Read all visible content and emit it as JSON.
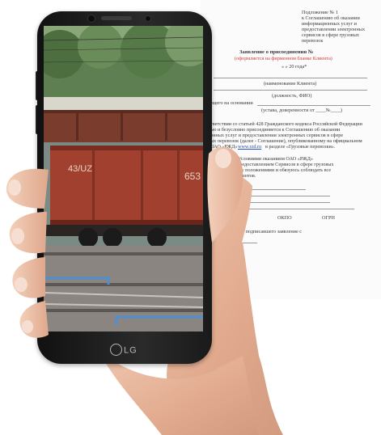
{
  "document": {
    "lines": [
      {
        "text": "Подложение № 1"
      },
      {
        "text": "к Соглашению об оказании"
      },
      {
        "text": "информационных услуг и"
      },
      {
        "text": "предоставлении электронных"
      },
      {
        "text": "сервисов в сфере грузовых"
      },
      {
        "text": "перевозок"
      },
      {
        "text": "Заявление о присоединении №"
      },
      {
        "text": "(оформляется на фирменном бланке Клиента)"
      },
      {
        "text": "«    »              20     года*"
      },
      {
        "text": "(наименование Клиента)"
      },
      {
        "text": "(должность, ФИО)"
      },
      {
        "text": "ющего на основании"
      },
      {
        "text": "(устава, доверенности от ____№____)"
      },
      {
        "text": "тветствии со статьей 428 Гражданского кодекса Российской Федерации"
      },
      {
        "text": "ью и безусловно присоединяется к Соглашению об оказании"
      },
      {
        "text": "онных услуг и предоставлении электронных сервисов в сфере"
      },
      {
        "text": "ых перевозок (далее - Соглашение), опубликованному на официальном"
      },
      {
        "text": "ОАО «РЖД»"
      },
      {
        "text": "www.rzd.ru"
      },
      {
        "text": "в разделе «Грузовые перевозки»."
      },
      {
        "text": "ляет также с Условиями оказанием ОАО «РЖД»"
      },
      {
        "text": "Услуг и/или предоставлением Сервисов в сфере грузовых"
      },
      {
        "text": "к нему положениями и обязуюсь соблюдать все"
      },
      {
        "text": "документов."
      },
      {
        "text": "ОКПО"
      },
      {
        "text": "ОГРН"
      },
      {
        "text": "олномочия лица, подписавшего заявление с"
      }
    ]
  },
  "phone": {
    "brand": "LG"
  },
  "screen": {
    "wagon_code": "43/UZ",
    "wagon_number": "653"
  }
}
